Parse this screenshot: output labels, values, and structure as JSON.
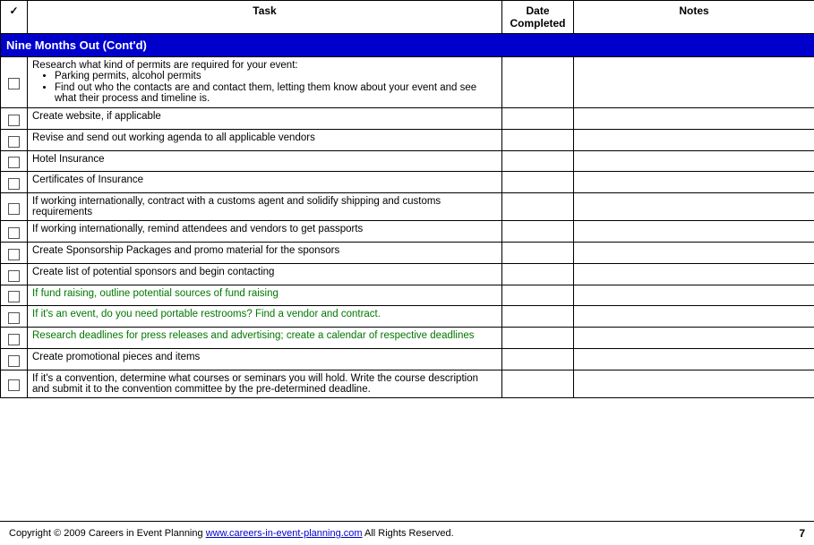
{
  "header": {
    "check_label": "✓",
    "task_label": "Task",
    "date_label": "Date Completed",
    "notes_label": "Notes"
  },
  "section": {
    "title": "Nine Months Out (Cont'd)"
  },
  "rows": [
    {
      "id": "row1",
      "task_html": "research_permits",
      "green": false,
      "multiline": true
    },
    {
      "id": "row2",
      "task": "Create website, if applicable",
      "green": false
    },
    {
      "id": "row3",
      "task": "Revise and send out working agenda to all applicable vendors",
      "green": false
    },
    {
      "id": "row4",
      "task": "Hotel Insurance",
      "green": false
    },
    {
      "id": "row5",
      "task": "Certificates of Insurance",
      "green": false
    },
    {
      "id": "row6",
      "task": "If working internationally, contract with a customs agent and solidify shipping and customs requirements",
      "green": false
    },
    {
      "id": "row7",
      "task": "If working internationally, remind attendees and vendors to get passports",
      "green": false
    },
    {
      "id": "row8",
      "task": "Create Sponsorship Packages and promo material for the sponsors",
      "green": false
    },
    {
      "id": "row9",
      "task": "Create list of potential sponsors and begin contacting",
      "green": false
    },
    {
      "id": "row10",
      "task": "If fund raising, outline potential sources of fund raising",
      "green": true
    },
    {
      "id": "row11",
      "task": "If it's an event, do you need portable restrooms?  Find a vendor and contract.",
      "green": true
    },
    {
      "id": "row12",
      "task": "Research deadlines for press releases and advertising; create a calendar of respective deadlines",
      "green": true
    },
    {
      "id": "row13",
      "task": "Create promotional pieces and items",
      "green": false
    },
    {
      "id": "row14",
      "task": "If it's a convention, determine what courses or seminars you will hold.  Write the course description and submit it to the convention committee by the pre-determined deadline.",
      "green": false
    }
  ],
  "footer": {
    "copyright": "Copyright © 2009  Careers in Event Planning",
    "link_text": "www.careers-in-event-planning.com",
    "link_url": "www.careers-in-event-planning.com",
    "rights": "   All Rights Reserved.",
    "page_number": "7"
  }
}
